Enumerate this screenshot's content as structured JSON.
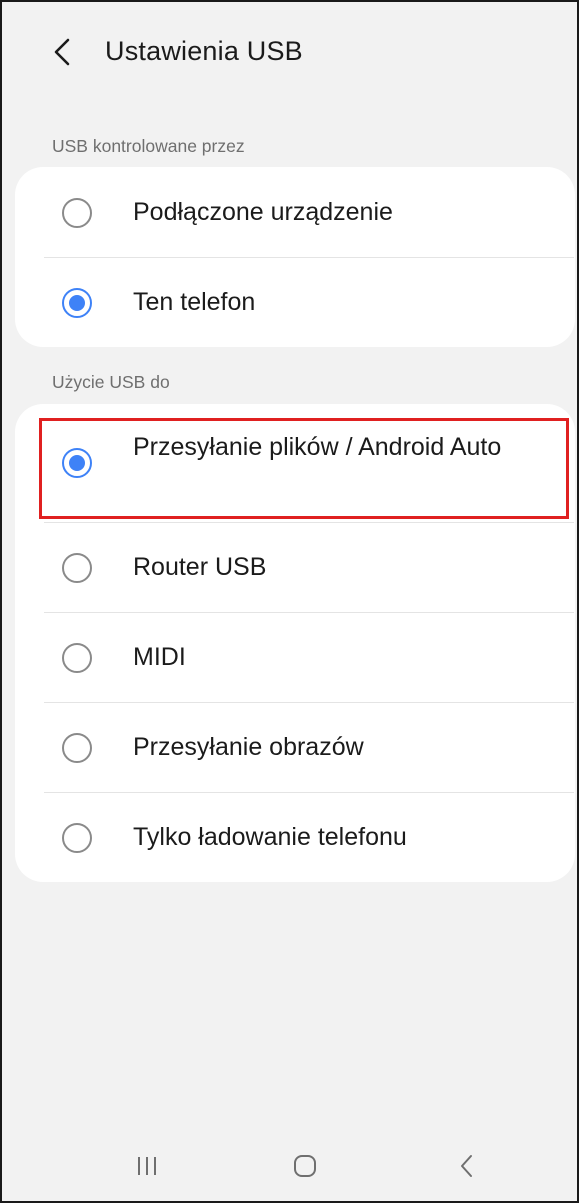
{
  "header": {
    "title": "Ustawienia USB",
    "back_icon": "chevron-left-icon"
  },
  "usb_controlled_by": {
    "label": "USB kontrolowane przez",
    "options": [
      {
        "label": "Podłączone urządzenie",
        "selected": false
      },
      {
        "label": "Ten telefon",
        "selected": true
      }
    ]
  },
  "usb_use_for": {
    "label": "Użycie USB do",
    "options": [
      {
        "label": "Przesyłanie plików / Android Auto",
        "selected": true
      },
      {
        "label": "Router USB",
        "selected": false
      },
      {
        "label": "MIDI",
        "selected": false
      },
      {
        "label": "Przesyłanie obrazów",
        "selected": false
      },
      {
        "label": "Tylko ładowanie telefonu",
        "selected": false
      }
    ]
  },
  "highlight": {
    "color": "#e02020",
    "target": "Przesyłanie plików / Android Auto"
  },
  "nav_bar": {
    "items": [
      "recent-apps-icon",
      "home-icon",
      "back-icon"
    ]
  },
  "colors": {
    "accent": "#3e82f7",
    "background": "#f2f2f2",
    "card": "#ffffff"
  }
}
